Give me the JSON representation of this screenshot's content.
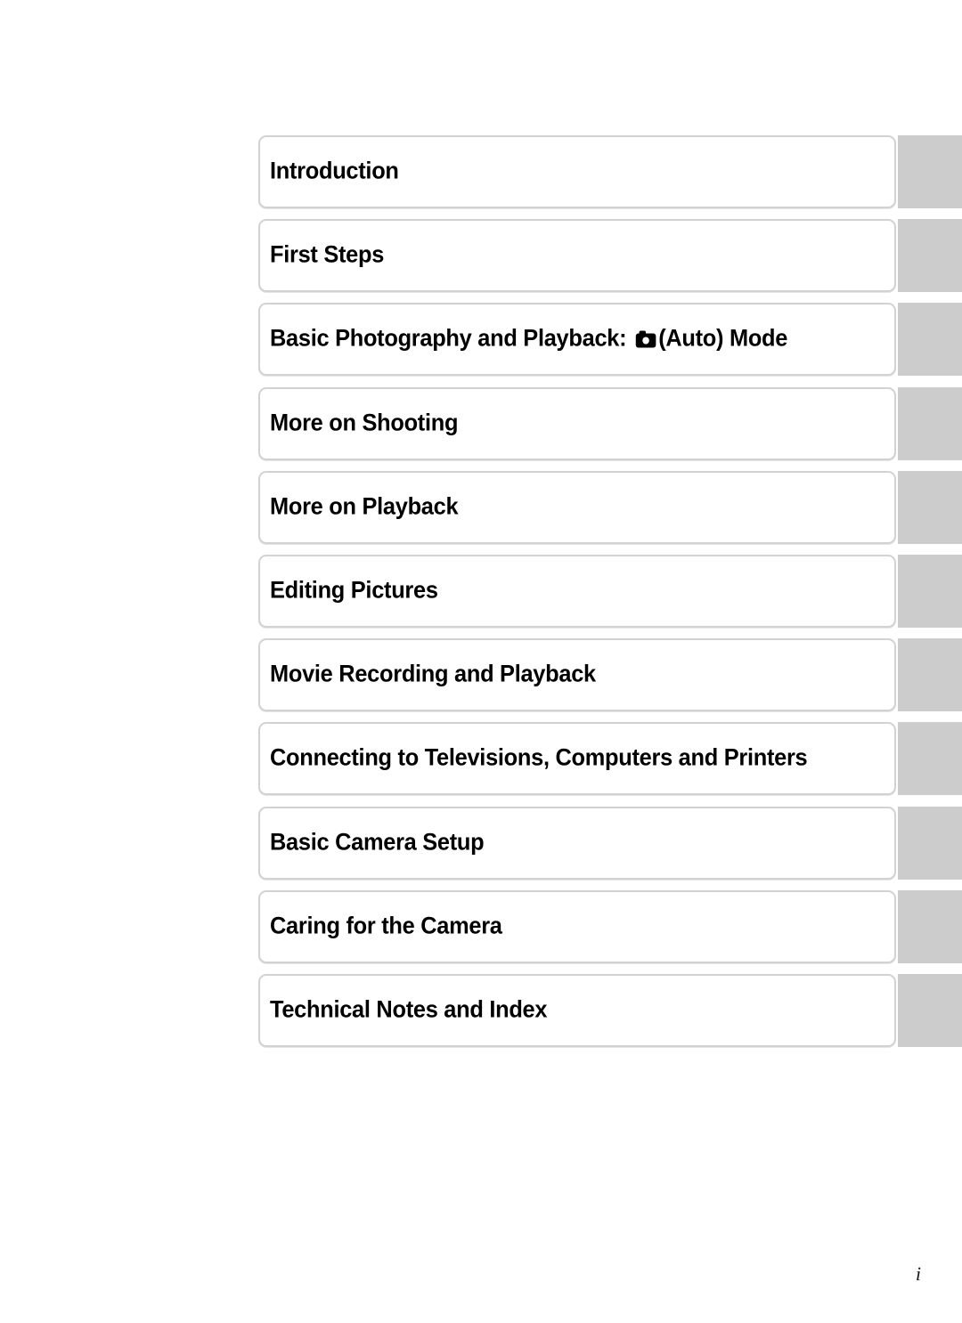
{
  "document": {
    "type": "manual-table-of-contents",
    "page_number": "i",
    "colors": {
      "tab_gray": "#cccccc",
      "box_border": "#d2d2d2",
      "text": "#000000",
      "background": "#ffffff"
    }
  },
  "toc": {
    "entries": [
      {
        "label": "Introduction",
        "icon": null
      },
      {
        "label": "First Steps",
        "icon": null
      },
      {
        "label_before_icon": "Basic Photography and Playback: ",
        "icon": "camera-auto-icon",
        "label_after_icon": "(Auto) Mode",
        "label": "Basic Photography and Playback: (Auto) Mode"
      },
      {
        "label": "More on Shooting",
        "icon": null
      },
      {
        "label": "More on Playback",
        "icon": null
      },
      {
        "label": "Editing Pictures",
        "icon": null
      },
      {
        "label": "Movie Recording and Playback",
        "icon": null
      },
      {
        "label": "Connecting to Televisions, Computers and Printers",
        "icon": null
      },
      {
        "label": "Basic Camera Setup",
        "icon": null
      },
      {
        "label": "Caring for the Camera",
        "icon": null
      },
      {
        "label": "Technical Notes and Index",
        "icon": null
      }
    ]
  }
}
